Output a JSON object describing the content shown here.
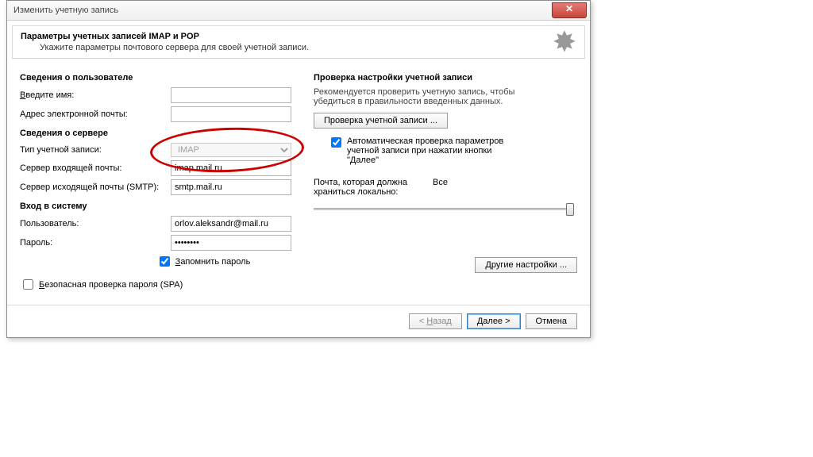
{
  "window": {
    "title": "Изменить учетную запись"
  },
  "header": {
    "title": "Параметры учетных записей IMAP и POP",
    "subtitle": "Укажите параметры почтового сервера для своей учетной записи."
  },
  "sections": {
    "user_info": "Сведения о пользователе",
    "server_info": "Сведения о сервере",
    "login_info": "Вход в систему",
    "test_settings": "Проверка настройки учетной записи"
  },
  "labels": {
    "name": "Введите имя:",
    "email": "Адрес электронной почты:",
    "account_type": "Тип учетной записи:",
    "incoming": "Сервер входящей почты:",
    "outgoing": "Сервер исходящей почты (SMTP):",
    "username": "Пользователь:",
    "password": "Пароль:",
    "remember_password": "Запомнить пароль",
    "spa": "Безопасная проверка пароля (SPA)",
    "offline_mail": "Почта, которая должна храниться локально:",
    "offline_val": "Все",
    "test_note": "Рекомендуется проверить учетную запись, чтобы убедиться в правильности введенных данных.",
    "auto_test": "Автоматическая проверка параметров учетной записи при нажатии кнопки \"Далее\""
  },
  "values": {
    "name": "",
    "email": "",
    "account_type": "IMAP",
    "incoming": "imap.mail.ru",
    "outgoing": "smtp.mail.ru",
    "username": "orlov.aleksandr@mail.ru",
    "password": "********"
  },
  "buttons": {
    "test_account": "Проверка учетной записи ...",
    "more_settings": "Другие настройки ...",
    "back": "< Назад",
    "next": "Далее >",
    "cancel": "Отмена"
  },
  "underlines": {
    "name_u": "В",
    "remember_u": "З",
    "spa_u": "Б",
    "back_u": "Н"
  }
}
